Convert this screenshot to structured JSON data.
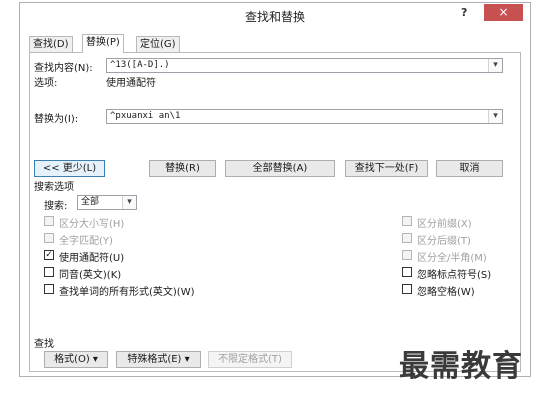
{
  "window": {
    "title": "查找和替换",
    "help": "?",
    "close": "×"
  },
  "tabs": [
    {
      "label": "查找(D)"
    },
    {
      "label": "替换(P)"
    },
    {
      "label": "定位(G)"
    }
  ],
  "find": {
    "label": "查找内容(N):",
    "value": "^13([A-D].)"
  },
  "options_line": {
    "label": "选项:",
    "value": "使用通配符"
  },
  "replace": {
    "label": "替换为(I):",
    "value": "^pxuanxi an\\1"
  },
  "buttons": {
    "less": "<< 更少(L)",
    "replace": "替换(R)",
    "replace_all": "全部替换(A)",
    "find_next": "查找下一处(F)",
    "cancel": "取消"
  },
  "search_options": {
    "heading": "搜索选项",
    "search_label": "搜索:",
    "search_value": "全部"
  },
  "checkboxes_left": [
    {
      "label": "区分大小写(H)",
      "checked": false,
      "enabled": false
    },
    {
      "label": "全字匹配(Y)",
      "checked": false,
      "enabled": false
    },
    {
      "label": "使用通配符(U)",
      "checked": true,
      "enabled": true
    },
    {
      "label": "同音(英文)(K)",
      "checked": false,
      "enabled": true
    },
    {
      "label": "查找单词的所有形式(英文)(W)",
      "checked": false,
      "enabled": true
    }
  ],
  "checkboxes_right": [
    {
      "label": "区分前缀(X)",
      "checked": false,
      "enabled": false
    },
    {
      "label": "区分后缀(T)",
      "checked": false,
      "enabled": false
    },
    {
      "label": "区分全/半角(M)",
      "checked": false,
      "enabled": false
    },
    {
      "label": "忽略标点符号(S)",
      "checked": false,
      "enabled": true
    },
    {
      "label": "忽略空格(W)",
      "checked": false,
      "enabled": true
    }
  ],
  "bottom": {
    "heading": "查找",
    "format": "格式(O) ▾",
    "special": "特殊格式(E) ▾",
    "no_format": "不限定格式(T)"
  },
  "watermark": "最需教育",
  "icons": {
    "dropdown": "▾",
    "check": "✓"
  }
}
